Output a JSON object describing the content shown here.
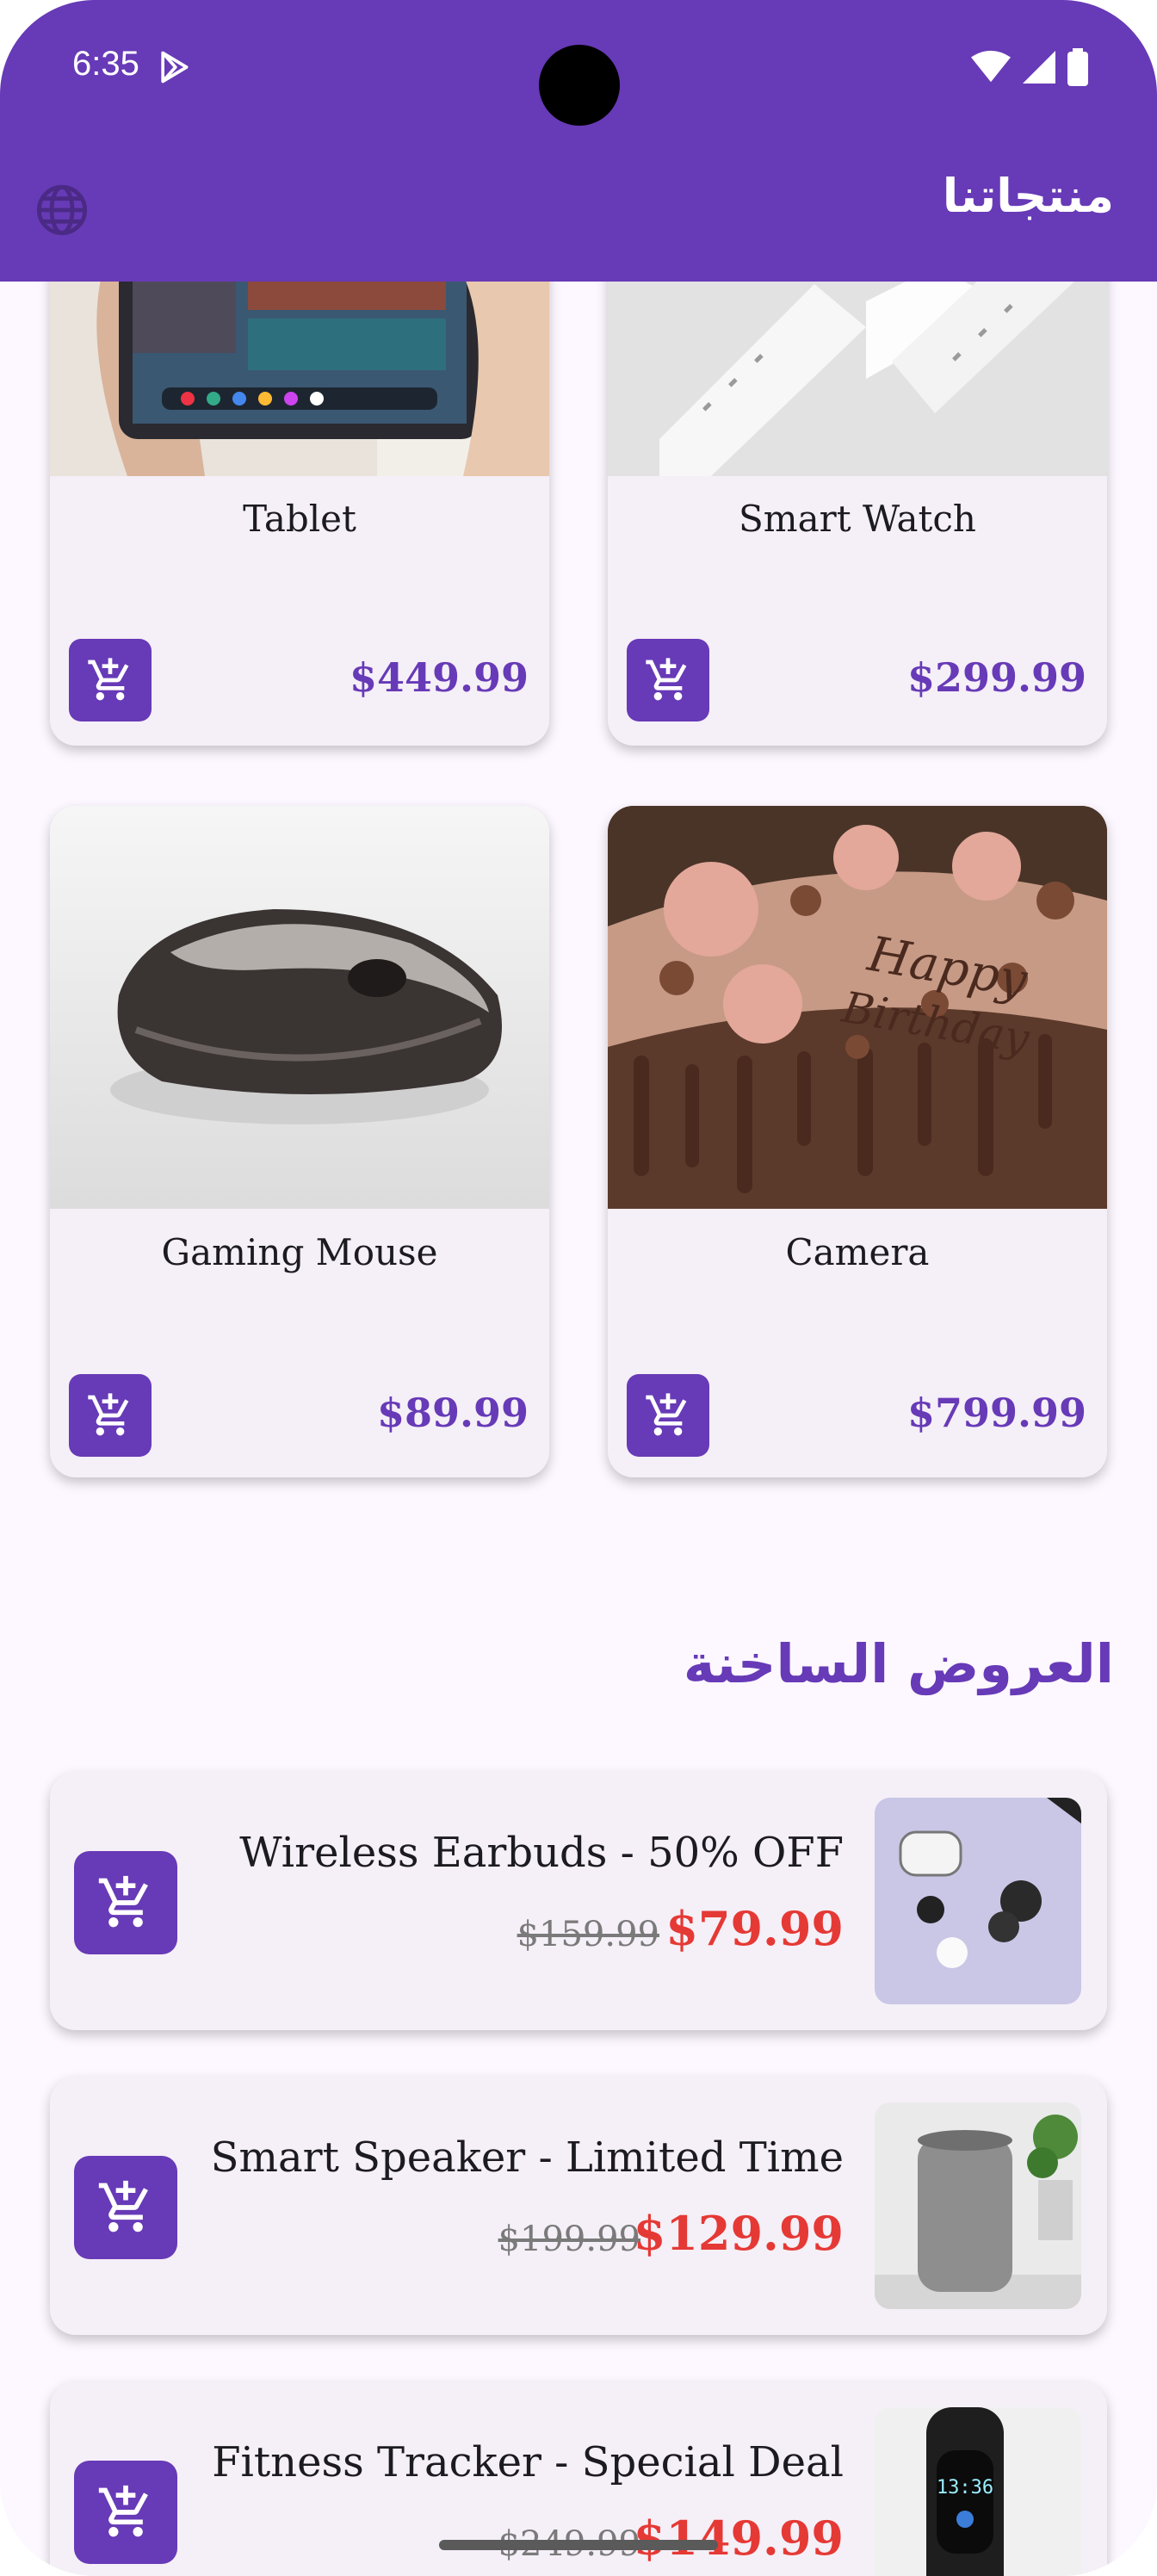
{
  "status_bar": {
    "time": "6:35"
  },
  "app_bar": {
    "title": "منتجاتنا",
    "language_icon": "globe-icon"
  },
  "products": [
    {
      "name": "Tablet",
      "price": "$449.99",
      "cart_icon": "add-shopping-cart-icon"
    },
    {
      "name": "Smart Watch",
      "price": "$299.99",
      "cart_icon": "add-shopping-cart-icon"
    },
    {
      "name": "Gaming Mouse",
      "price": "$89.99",
      "cart_icon": "add-shopping-cart-icon"
    },
    {
      "name": "Camera",
      "price": "$799.99",
      "cart_icon": "add-shopping-cart-icon"
    }
  ],
  "hot_deals": {
    "title": "العروض الساخنة",
    "items": [
      {
        "title": "Wireless Earbuds - 50% OFF",
        "old_price": "$159.99",
        "new_price": "$79.99"
      },
      {
        "title": "Smart Speaker - Limited Time",
        "old_price": "$199.99",
        "new_price": "$129.99"
      },
      {
        "title": "Fitness Tracker - Special Deal",
        "old_price": "$249.99",
        "new_price": "$149.99"
      }
    ]
  },
  "colors": {
    "primary": "#673ab7",
    "sale": "#e53935",
    "surface": "#f5eff7",
    "background": "#fdf7ff"
  }
}
